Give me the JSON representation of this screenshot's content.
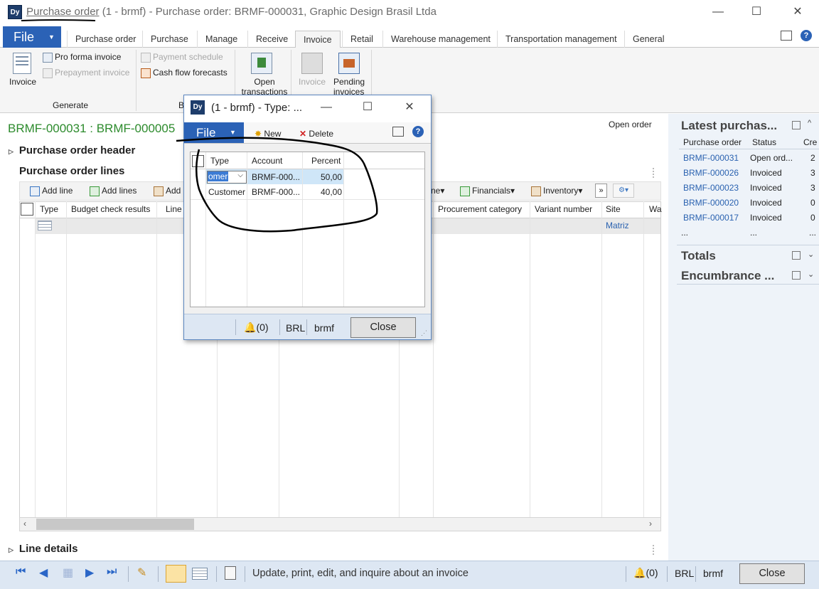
{
  "window": {
    "title_link": "Purchase order",
    "title_rest": "(1 - brmf) - Purchase order: BRMF-000031, Graphic Design Brasil Ltda",
    "logo_text": "Dy"
  },
  "ribbon_tabs": [
    "Purchase order",
    "Purchase",
    "Manage",
    "Receive",
    "Invoice",
    "Retail",
    "Warehouse management",
    "Transportation management",
    "General"
  ],
  "file_label": "File",
  "ribbon": {
    "invoice": "Invoice",
    "pro_forma": "Pro forma invoice",
    "prepayment": "Prepayment invoice",
    "payment_schedule": "Payment schedule",
    "cash_flow": "Cash flow forecasts",
    "open_transactions": "Open transactions",
    "invoice_disabled": "Invoice",
    "pending_invoices": "Pending invoices",
    "group_generate": "Generate",
    "group_b": "B"
  },
  "main": {
    "record_title": "BRMF-000031 : BRMF-000005",
    "status": "Open order",
    "header_section": "Purchase order header",
    "lines_section": "Purchase order lines",
    "line_details": "Line details",
    "toolbar": {
      "add_line": "Add line",
      "add_lines": "Add lines",
      "add": "Add",
      "line_menu": "ne",
      "financials": "Financials",
      "inventory": "Inventory"
    },
    "columns": [
      "Type",
      "Budget check results",
      "Line",
      "Procurement category",
      "Variant number",
      "Site",
      "Wa"
    ],
    "row_site": "Matriz"
  },
  "right_panel": {
    "title": "Latest purchas...",
    "columns": [
      "Purchase order",
      "Status",
      "Cre"
    ],
    "rows": [
      {
        "po": "BRMF-000031",
        "status": "Open ord...",
        "cre": "2"
      },
      {
        "po": "BRMF-000026",
        "status": "Invoiced",
        "cre": "3"
      },
      {
        "po": "BRMF-000023",
        "status": "Invoiced",
        "cre": "3"
      },
      {
        "po": "BRMF-000020",
        "status": "Invoiced",
        "cre": "0"
      },
      {
        "po": "BRMF-000017",
        "status": "Invoiced",
        "cre": "0"
      }
    ],
    "ellipsis": "...",
    "totals": "Totals",
    "encumbrance": "Encumbrance ..."
  },
  "statusbar": {
    "text": "Update, print, edit, and inquire about an invoice",
    "notifications": "(0)",
    "currency": "BRL",
    "company": "brmf",
    "close": "Close"
  },
  "dialog": {
    "title": "(1 - brmf) - Type: ...",
    "file": "File",
    "new": "New",
    "delete": "Delete",
    "columns": [
      "Type",
      "Account",
      "Percent"
    ],
    "rows": [
      {
        "type": "omer",
        "account": "BRMF-000...",
        "percent": "50,00"
      },
      {
        "type": "Customer",
        "account": "BRMF-000...",
        "percent": "40,00"
      }
    ],
    "notifications": "(0)",
    "currency": "BRL",
    "company": "brmf",
    "close": "Close"
  }
}
